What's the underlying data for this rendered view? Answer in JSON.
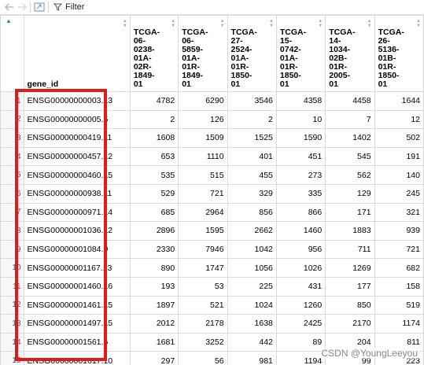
{
  "toolbar": {
    "filter_label": "Filter"
  },
  "table": {
    "columns": [
      {
        "label": "gene_id"
      },
      {
        "label": "TCGA-\n06-\n0238-\n01A-\n02R-\n1849-\n01"
      },
      {
        "label": "TCGA-\n06-\n5859-\n01A-\n01R-\n1849-\n01"
      },
      {
        "label": "TCGA-\n27-\n2524-\n01A-\n01R-\n1850-\n01"
      },
      {
        "label": "TCGA-\n15-\n0742-\n01A-\n01R-\n1850-\n01"
      },
      {
        "label": "TCGA-\n14-\n1034-\n02B-\n01R-\n2005-\n01"
      },
      {
        "label": "TCGA-\n26-\n5136-\n01B-\n01R-\n1850-\n01"
      }
    ],
    "rows": [
      {
        "num": "1",
        "cells": [
          "ENSG00000000003.13",
          "4782",
          "6290",
          "3546",
          "4358",
          "4458",
          "1644"
        ]
      },
      {
        "num": "2",
        "cells": [
          "ENSG00000000005.5",
          "2",
          "126",
          "2",
          "10",
          "7",
          "12"
        ]
      },
      {
        "num": "3",
        "cells": [
          "ENSG00000000419.11",
          "1608",
          "1509",
          "1525",
          "1590",
          "1402",
          "502"
        ]
      },
      {
        "num": "4",
        "cells": [
          "ENSG00000000457.12",
          "653",
          "1110",
          "401",
          "451",
          "545",
          "191"
        ]
      },
      {
        "num": "5",
        "cells": [
          "ENSG00000000460.15",
          "535",
          "515",
          "455",
          "273",
          "562",
          "140"
        ]
      },
      {
        "num": "6",
        "cells": [
          "ENSG00000000938.11",
          "529",
          "721",
          "329",
          "335",
          "129",
          "245"
        ]
      },
      {
        "num": "7",
        "cells": [
          "ENSG00000000971.14",
          "685",
          "2964",
          "856",
          "866",
          "171",
          "321"
        ]
      },
      {
        "num": "8",
        "cells": [
          "ENSG00000001036.12",
          "2896",
          "1595",
          "2662",
          "1460",
          "1883",
          "939"
        ]
      },
      {
        "num": "9",
        "cells": [
          "ENSG00000001084.9",
          "2330",
          "7946",
          "1042",
          "956",
          "711",
          "721"
        ]
      },
      {
        "num": "10",
        "cells": [
          "ENSG00000001167.13",
          "890",
          "1747",
          "1056",
          "1026",
          "1269",
          "682"
        ]
      },
      {
        "num": "11",
        "cells": [
          "ENSG00000001460.16",
          "193",
          "53",
          "225",
          "431",
          "177",
          "158"
        ]
      },
      {
        "num": "12",
        "cells": [
          "ENSG00000001461.15",
          "1897",
          "521",
          "1024",
          "1260",
          "850",
          "519"
        ]
      },
      {
        "num": "13",
        "cells": [
          "ENSG00000001497.15",
          "2012",
          "2178",
          "1638",
          "2425",
          "2170",
          "1174"
        ]
      },
      {
        "num": "14",
        "cells": [
          "ENSG00000001561.6",
          "1681",
          "3252",
          "442",
          "89",
          "204",
          "811"
        ]
      },
      {
        "num": "15",
        "cells": [
          "ENSG00000001617.10",
          "297",
          "56",
          "981",
          "1194",
          "99",
          "223"
        ]
      }
    ]
  },
  "watermark": "CSDN @YoungLeeyou"
}
